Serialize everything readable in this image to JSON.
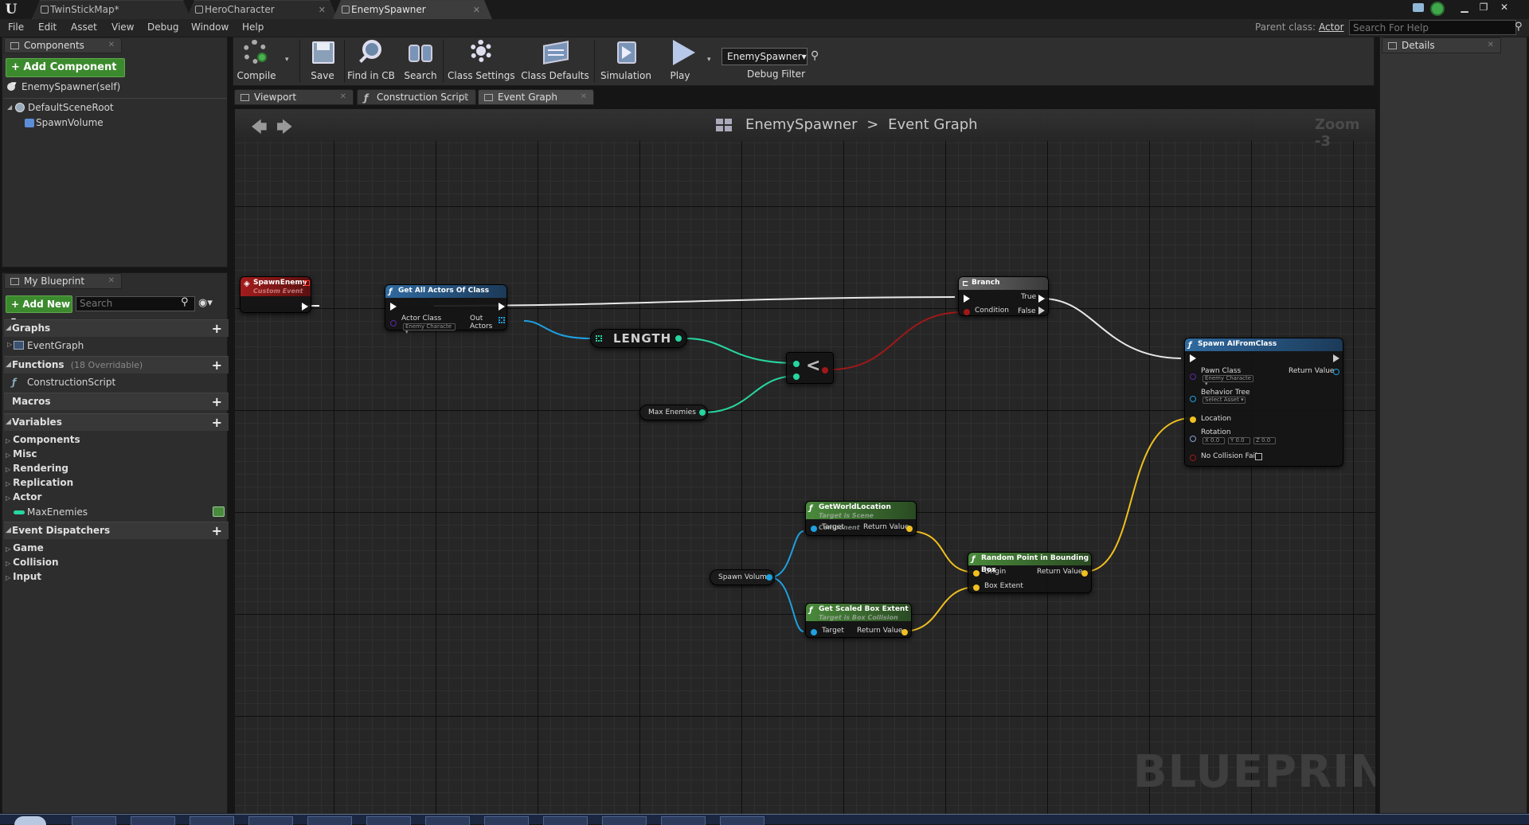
{
  "tabs": [
    {
      "label": "TwinStickMap*",
      "active": false
    },
    {
      "label": "HeroCharacter",
      "active": false
    },
    {
      "label": "EnemySpawner",
      "active": true
    }
  ],
  "menu": [
    "File",
    "Edit",
    "Asset",
    "View",
    "Debug",
    "Window",
    "Help"
  ],
  "parent_class": {
    "label": "Parent class:",
    "value": "Actor"
  },
  "help_search_placeholder": "Search For Help",
  "components_panel": {
    "tab": "Components",
    "add_button": "+ Add Component ▾",
    "self_item": "EnemySpawner(self)",
    "tree": [
      "DefaultSceneRoot",
      "SpawnVolume"
    ]
  },
  "my_blueprint": {
    "tab": "My Blueprint",
    "add_new": "+ Add New ▾",
    "search_placeholder": "Search",
    "categories": {
      "graphs": "Graphs",
      "graphs_items": [
        "EventGraph"
      ],
      "functions": "Functions",
      "functions_note": "(18 Overridable)",
      "functions_items": [
        "ConstructionScript"
      ],
      "macros": "Macros",
      "variables": "Variables",
      "variable_groups": [
        "Components",
        "Misc",
        "Rendering",
        "Replication",
        "Actor"
      ],
      "variable_items": [
        "MaxEnemies"
      ],
      "event_dispatchers": "Event Dispatchers",
      "dispatcher_groups": [
        "Game",
        "Collision",
        "Input"
      ]
    }
  },
  "toolbar": {
    "buttons": [
      "Compile",
      "Save",
      "Find in CB",
      "Search",
      "Class Settings",
      "Class Defaults",
      "Simulation",
      "Play"
    ],
    "debug_object": "EnemySpawner▾",
    "debug_filter": "Debug Filter"
  },
  "editor_tabs": [
    "Viewport",
    "Construction Script",
    "Event Graph"
  ],
  "details_tab": "Details",
  "graph": {
    "breadcrumb_root": "EnemySpawner",
    "breadcrumb_sep": ">",
    "breadcrumb_leaf": "Event Graph",
    "zoom": "Zoom -3",
    "watermark": "BLUEPRINT",
    "nodes": {
      "spawn_enemy": {
        "title": "SpawnEnemy",
        "subtitle": "Custom Event"
      },
      "get_all_actors": {
        "title": "Get All Actors Of Class",
        "in": "Actor Class",
        "out": "Out Actors",
        "field": "Enemy Characte ▾"
      },
      "length": {
        "title": "LENGTH"
      },
      "less": {
        "title": "<"
      },
      "max_enemies": {
        "title": "Max Enemies"
      },
      "branch": {
        "title": "Branch",
        "condition": "Condition",
        "true": "True",
        "false": "False"
      },
      "spawn_ai": {
        "title": "Spawn AIFromClass",
        "pawn_class": "Pawn Class",
        "pawn_field": "Enemy Characte ▾",
        "return": "Return Value",
        "behavior_tree": "Behavior Tree",
        "bt_field": "Select Asset ▾",
        "location": "Location",
        "rotation": "Rotation",
        "rot_x": "X 0.0",
        "rot_y": "Y 0.0",
        "rot_z": "Z 0.0",
        "no_collision": "No Collision Fail"
      },
      "get_world_location": {
        "title": "GetWorldLocation",
        "subtitle": "Target is Scene Component",
        "target": "Target",
        "return": "Return Value"
      },
      "spawn_volume": {
        "title": "Spawn Volume"
      },
      "get_scaled_box": {
        "title": "Get Scaled Box Extent",
        "subtitle": "Target is Box Collision",
        "target": "Target",
        "return": "Return Value"
      },
      "random_point": {
        "title": "Random Point in Bounding Box",
        "origin": "Origin",
        "extent": "Box Extent",
        "return": "Return Value"
      }
    }
  },
  "colors": {
    "exec": "#ffffff",
    "object": "#1fa0e0",
    "int": "#27d6a0",
    "bool": "#a01818",
    "vector": "#f0c020",
    "class": "#5a2aa0",
    "event_header": "#a31c1c",
    "func_header": "#2f6aa0",
    "pure_header": "#4a8a3c"
  }
}
